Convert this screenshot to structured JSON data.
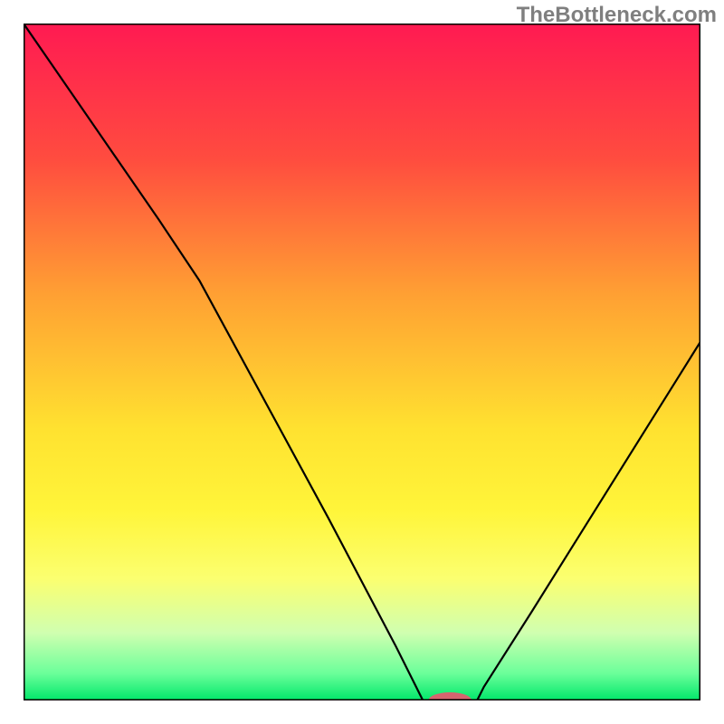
{
  "watermark": "TheBottleneck.com",
  "chart_data": {
    "type": "line",
    "title": "",
    "xlabel": "",
    "ylabel": "",
    "ylim": [
      0,
      100
    ],
    "xlim": [
      0,
      100
    ],
    "gradient_stops": [
      {
        "offset": 0.0,
        "color": "#ff1a52"
      },
      {
        "offset": 0.2,
        "color": "#ff4c3f"
      },
      {
        "offset": 0.4,
        "color": "#ffa033"
      },
      {
        "offset": 0.6,
        "color": "#ffe230"
      },
      {
        "offset": 0.72,
        "color": "#fff53a"
      },
      {
        "offset": 0.82,
        "color": "#fbff70"
      },
      {
        "offset": 0.9,
        "color": "#d0ffb0"
      },
      {
        "offset": 0.96,
        "color": "#6bff9a"
      },
      {
        "offset": 1.0,
        "color": "#00e76a"
      }
    ],
    "curve": [
      {
        "x": 0,
        "y": 100
      },
      {
        "x": 20,
        "y": 71
      },
      {
        "x": 26,
        "y": 62
      },
      {
        "x": 45,
        "y": 27
      },
      {
        "x": 55,
        "y": 8
      },
      {
        "x": 58,
        "y": 2
      },
      {
        "x": 59,
        "y": 0
      },
      {
        "x": 67,
        "y": 0
      },
      {
        "x": 68,
        "y": 2
      },
      {
        "x": 75,
        "y": 13
      },
      {
        "x": 85,
        "y": 29
      },
      {
        "x": 95,
        "y": 45
      },
      {
        "x": 100,
        "y": 53
      }
    ],
    "marker": {
      "x": 63,
      "y": 0,
      "rx": 3.2,
      "ry": 1.2,
      "color": "#d6646f"
    },
    "frame_stroke": "#000000",
    "curve_stroke": "#000000",
    "curve_width": 2.2
  }
}
